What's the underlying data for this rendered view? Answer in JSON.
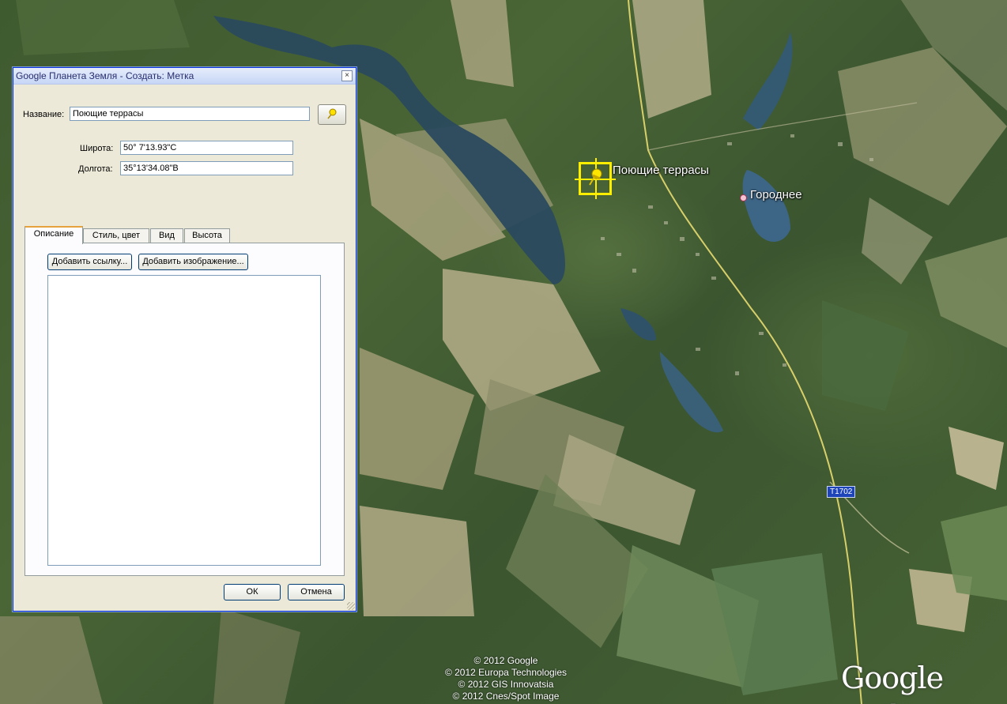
{
  "dialog": {
    "title": "Google Планета Земля - Создать: Метка",
    "name_label": "Название:",
    "name_value": "Поющие террасы",
    "lat_label": "Широта:",
    "lat_value": "50° 7'13.93\"С",
    "lon_label": "Долгота:",
    "lon_value": "35°13'34.08\"В",
    "tabs": [
      "Описание",
      "Стиль, цвет",
      "Вид",
      "Высота"
    ],
    "active_tab": "Описание",
    "add_link_label": "Добавить ссылку...",
    "add_image_label": "Добавить изображение...",
    "description_value": "",
    "ok_label": "ОК",
    "cancel_label": "Отмена",
    "close_glyph": "×"
  },
  "map": {
    "placemark_label": "Поющие террасы",
    "town_label": "Городнее",
    "road_label": "T1702",
    "copyright": [
      "© 2012 Google",
      "© 2012 Europa Technologies",
      "© 2012 GIS Innovatsia",
      "© 2012 Cnes/Spot Image"
    ],
    "logo_google": "Google",
    "logo_earth": "earth",
    "colors": {
      "highlight": "#ffee00",
      "road_badge": "#1d44b8",
      "dialog_border": "#0831d9"
    }
  }
}
